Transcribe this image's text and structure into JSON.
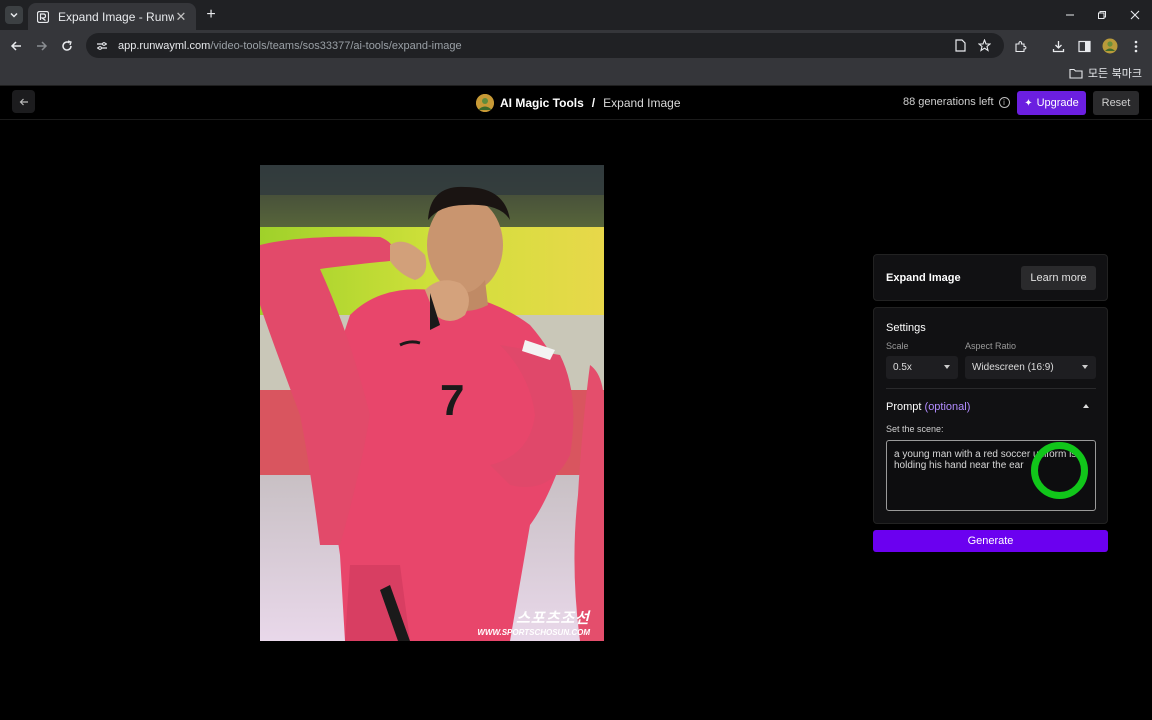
{
  "browser": {
    "tab_title": "Expand Image - Runway",
    "url_host": "app.runwayml.com",
    "url_path": "/video-tools/teams/sos33377/ai-tools/expand-image",
    "bookmarks_label": "모든 북마크"
  },
  "header": {
    "app_name": "AI Magic Tools",
    "separator": "/",
    "page_name": "Expand Image",
    "generations_left": "88 generations left",
    "upgrade_label": "Upgrade",
    "reset_label": "Reset"
  },
  "image": {
    "watermark_brand": "스포츠조선",
    "watermark_url": "WWW.SPORTSCHOSUN.COM",
    "jersey_number": "7"
  },
  "panel": {
    "title": "Expand Image",
    "learn_more_label": "Learn more",
    "settings_title": "Settings",
    "scale_label": "Scale",
    "scale_value": "0.5x",
    "aspect_label": "Aspect Ratio",
    "aspect_value": "Widescreen (16:9)",
    "prompt_title": "Prompt",
    "prompt_optional": "(optional)",
    "scene_label": "Set the scene:",
    "prompt_text": "a young man with a red soccer uniform is holding his hand near the ear",
    "generate_label": "Generate"
  },
  "colors": {
    "accent": "#6b00f0",
    "upgrade": "#6b1fe0",
    "cursor_highlight": "#11c61a",
    "jersey": "#e8466b"
  }
}
